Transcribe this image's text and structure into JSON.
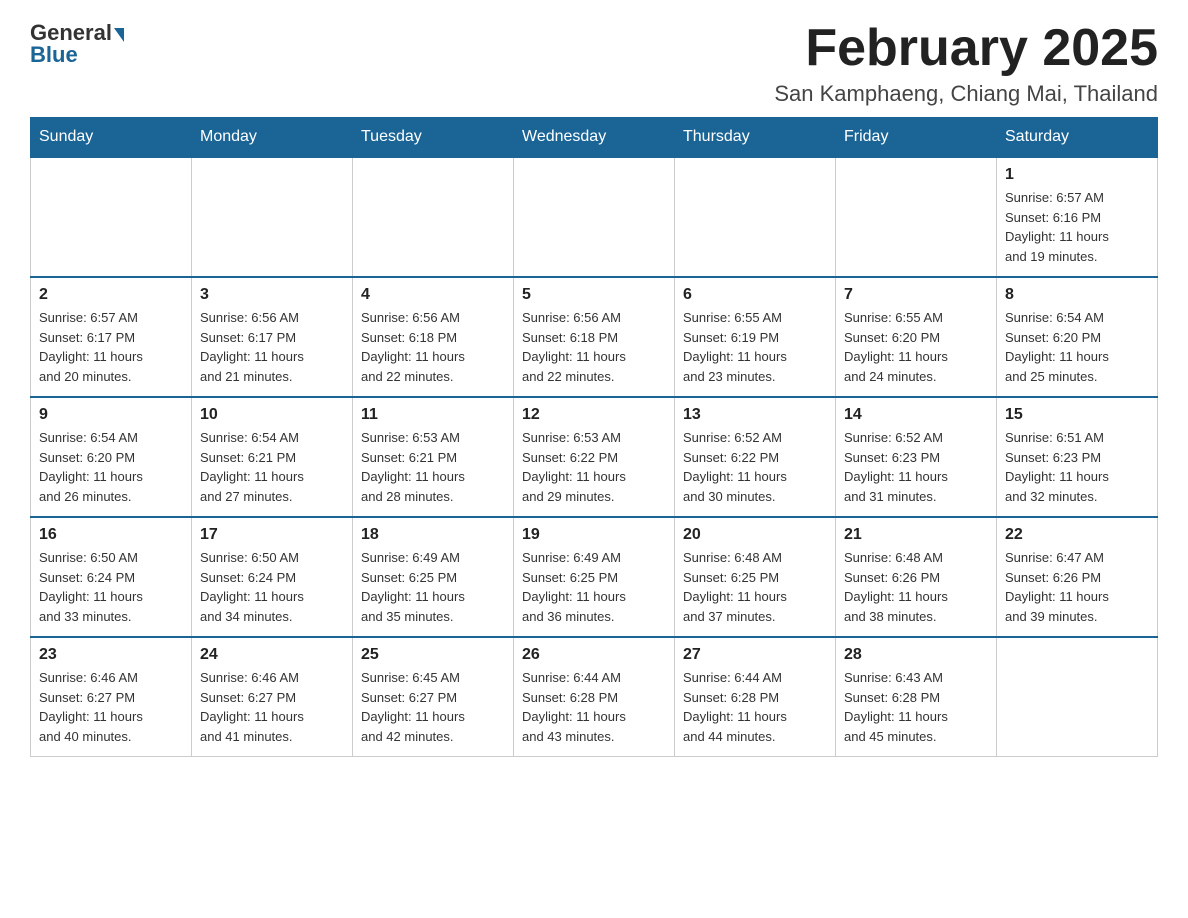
{
  "header": {
    "logo_general": "General",
    "logo_blue": "Blue",
    "title": "February 2025",
    "location": "San Kamphaeng, Chiang Mai, Thailand"
  },
  "weekdays": [
    "Sunday",
    "Monday",
    "Tuesday",
    "Wednesday",
    "Thursday",
    "Friday",
    "Saturday"
  ],
  "weeks": [
    [
      {
        "day": "",
        "info": ""
      },
      {
        "day": "",
        "info": ""
      },
      {
        "day": "",
        "info": ""
      },
      {
        "day": "",
        "info": ""
      },
      {
        "day": "",
        "info": ""
      },
      {
        "day": "",
        "info": ""
      },
      {
        "day": "1",
        "info": "Sunrise: 6:57 AM\nSunset: 6:16 PM\nDaylight: 11 hours\nand 19 minutes."
      }
    ],
    [
      {
        "day": "2",
        "info": "Sunrise: 6:57 AM\nSunset: 6:17 PM\nDaylight: 11 hours\nand 20 minutes."
      },
      {
        "day": "3",
        "info": "Sunrise: 6:56 AM\nSunset: 6:17 PM\nDaylight: 11 hours\nand 21 minutes."
      },
      {
        "day": "4",
        "info": "Sunrise: 6:56 AM\nSunset: 6:18 PM\nDaylight: 11 hours\nand 22 minutes."
      },
      {
        "day": "5",
        "info": "Sunrise: 6:56 AM\nSunset: 6:18 PM\nDaylight: 11 hours\nand 22 minutes."
      },
      {
        "day": "6",
        "info": "Sunrise: 6:55 AM\nSunset: 6:19 PM\nDaylight: 11 hours\nand 23 minutes."
      },
      {
        "day": "7",
        "info": "Sunrise: 6:55 AM\nSunset: 6:20 PM\nDaylight: 11 hours\nand 24 minutes."
      },
      {
        "day": "8",
        "info": "Sunrise: 6:54 AM\nSunset: 6:20 PM\nDaylight: 11 hours\nand 25 minutes."
      }
    ],
    [
      {
        "day": "9",
        "info": "Sunrise: 6:54 AM\nSunset: 6:20 PM\nDaylight: 11 hours\nand 26 minutes."
      },
      {
        "day": "10",
        "info": "Sunrise: 6:54 AM\nSunset: 6:21 PM\nDaylight: 11 hours\nand 27 minutes."
      },
      {
        "day": "11",
        "info": "Sunrise: 6:53 AM\nSunset: 6:21 PM\nDaylight: 11 hours\nand 28 minutes."
      },
      {
        "day": "12",
        "info": "Sunrise: 6:53 AM\nSunset: 6:22 PM\nDaylight: 11 hours\nand 29 minutes."
      },
      {
        "day": "13",
        "info": "Sunrise: 6:52 AM\nSunset: 6:22 PM\nDaylight: 11 hours\nand 30 minutes."
      },
      {
        "day": "14",
        "info": "Sunrise: 6:52 AM\nSunset: 6:23 PM\nDaylight: 11 hours\nand 31 minutes."
      },
      {
        "day": "15",
        "info": "Sunrise: 6:51 AM\nSunset: 6:23 PM\nDaylight: 11 hours\nand 32 minutes."
      }
    ],
    [
      {
        "day": "16",
        "info": "Sunrise: 6:50 AM\nSunset: 6:24 PM\nDaylight: 11 hours\nand 33 minutes."
      },
      {
        "day": "17",
        "info": "Sunrise: 6:50 AM\nSunset: 6:24 PM\nDaylight: 11 hours\nand 34 minutes."
      },
      {
        "day": "18",
        "info": "Sunrise: 6:49 AM\nSunset: 6:25 PM\nDaylight: 11 hours\nand 35 minutes."
      },
      {
        "day": "19",
        "info": "Sunrise: 6:49 AM\nSunset: 6:25 PM\nDaylight: 11 hours\nand 36 minutes."
      },
      {
        "day": "20",
        "info": "Sunrise: 6:48 AM\nSunset: 6:25 PM\nDaylight: 11 hours\nand 37 minutes."
      },
      {
        "day": "21",
        "info": "Sunrise: 6:48 AM\nSunset: 6:26 PM\nDaylight: 11 hours\nand 38 minutes."
      },
      {
        "day": "22",
        "info": "Sunrise: 6:47 AM\nSunset: 6:26 PM\nDaylight: 11 hours\nand 39 minutes."
      }
    ],
    [
      {
        "day": "23",
        "info": "Sunrise: 6:46 AM\nSunset: 6:27 PM\nDaylight: 11 hours\nand 40 minutes."
      },
      {
        "day": "24",
        "info": "Sunrise: 6:46 AM\nSunset: 6:27 PM\nDaylight: 11 hours\nand 41 minutes."
      },
      {
        "day": "25",
        "info": "Sunrise: 6:45 AM\nSunset: 6:27 PM\nDaylight: 11 hours\nand 42 minutes."
      },
      {
        "day": "26",
        "info": "Sunrise: 6:44 AM\nSunset: 6:28 PM\nDaylight: 11 hours\nand 43 minutes."
      },
      {
        "day": "27",
        "info": "Sunrise: 6:44 AM\nSunset: 6:28 PM\nDaylight: 11 hours\nand 44 minutes."
      },
      {
        "day": "28",
        "info": "Sunrise: 6:43 AM\nSunset: 6:28 PM\nDaylight: 11 hours\nand 45 minutes."
      },
      {
        "day": "",
        "info": ""
      }
    ]
  ]
}
